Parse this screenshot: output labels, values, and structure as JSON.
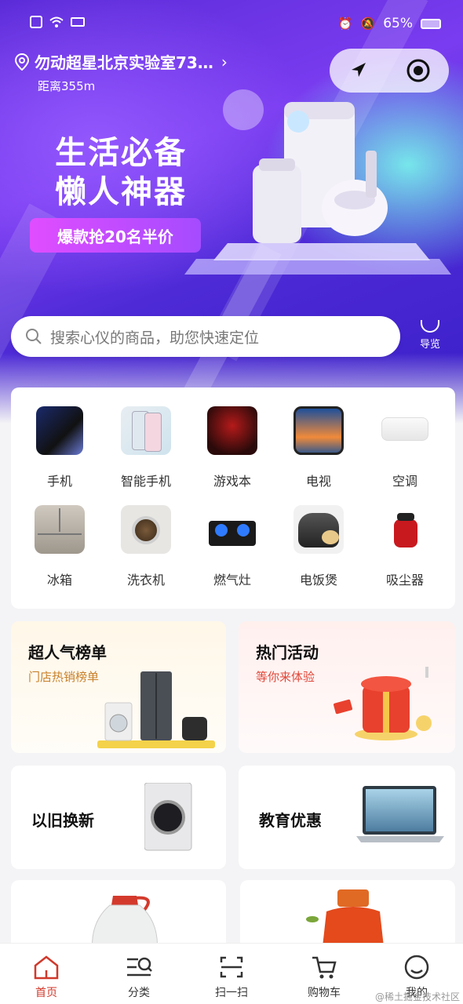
{
  "status_bar": {
    "battery": "65%"
  },
  "location": {
    "store_name": "勿动超星北京实验室73…",
    "arrow": "›",
    "distance": "距离355m"
  },
  "banner": {
    "title_line1": "生活必备",
    "title_line2": "懒人神器",
    "button": "爆款抢20名半价"
  },
  "search": {
    "placeholder": "搜索心仪的商品，助您快速定位"
  },
  "guide": {
    "label": "导览"
  },
  "categories": [
    {
      "label": "手机",
      "icon": "phone-icon"
    },
    {
      "label": "智能手机",
      "icon": "smartphone-icon"
    },
    {
      "label": "游戏本",
      "icon": "gaming-laptop-icon"
    },
    {
      "label": "电视",
      "icon": "tv-icon"
    },
    {
      "label": "空调",
      "icon": "air-conditioner-icon"
    },
    {
      "label": "冰箱",
      "icon": "fridge-icon"
    },
    {
      "label": "洗衣机",
      "icon": "washing-machine-icon"
    },
    {
      "label": "燃气灶",
      "icon": "gas-stove-icon"
    },
    {
      "label": "电饭煲",
      "icon": "rice-cooker-icon"
    },
    {
      "label": "吸尘器",
      "icon": "vacuum-icon"
    }
  ],
  "promos": {
    "ranking": {
      "title": "超人气榜单",
      "subtitle": "门店热销榜单"
    },
    "events": {
      "title": "热门活动",
      "subtitle": "等你来体验"
    },
    "trade_in": {
      "title": "以旧换新"
    },
    "education": {
      "title": "教育优惠"
    }
  },
  "bottom_nav": [
    {
      "label": "首页",
      "icon": "home-icon",
      "active": true
    },
    {
      "label": "分类",
      "icon": "category-icon",
      "active": false
    },
    {
      "label": "扫一扫",
      "icon": "scan-icon",
      "active": false
    },
    {
      "label": "购物车",
      "icon": "cart-icon",
      "active": false
    },
    {
      "label": "我的",
      "icon": "profile-icon",
      "active": false
    }
  ],
  "watermark": "@稀土掘金技术社区",
  "colors": {
    "accent_red": "#d0392b",
    "hero_purple": "#6a35e6",
    "promo_pink": "#e04dff",
    "ranking_sub": "#c8802a",
    "events_sub": "#e0483a"
  }
}
